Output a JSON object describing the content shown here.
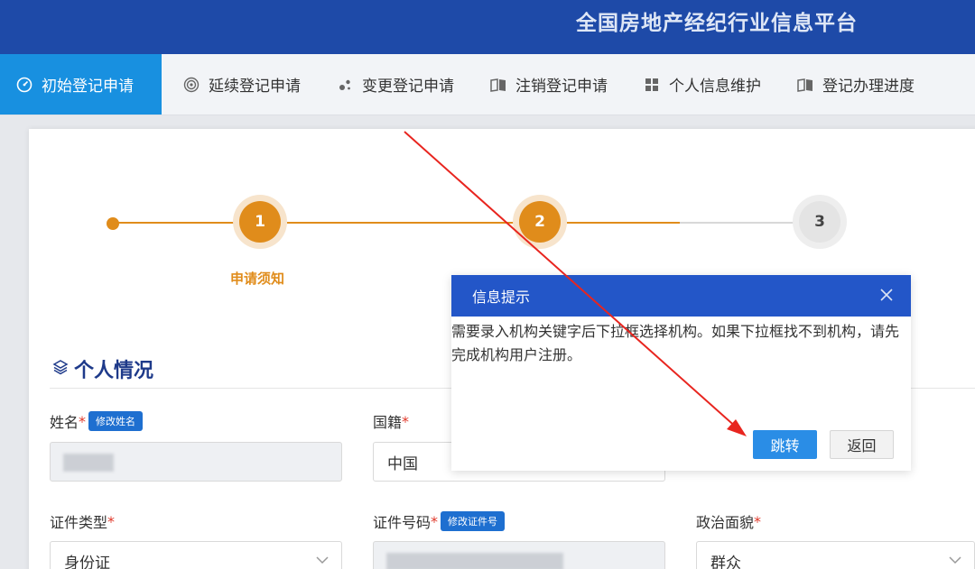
{
  "header": {
    "title": "全国房地产经纪行业信息平台"
  },
  "nav": {
    "items": [
      {
        "label": "初始登记申请",
        "icon": "dashboard-icon",
        "active": true
      },
      {
        "label": "延续登记申请",
        "icon": "target-icon"
      },
      {
        "label": "变更登记申请",
        "icon": "dots-icon"
      },
      {
        "label": "注销登记申请",
        "icon": "book-icon"
      },
      {
        "label": "个人信息维护",
        "icon": "grid-icon"
      },
      {
        "label": "登记办理进度",
        "icon": "book-icon"
      }
    ]
  },
  "stepper": {
    "steps": [
      {
        "number": "1",
        "label": "申请须知",
        "state": "done"
      },
      {
        "number": "2",
        "label": "",
        "state": "active"
      },
      {
        "number": "3",
        "label": "",
        "state": "pending"
      }
    ]
  },
  "section": {
    "title": "个人情况",
    "icon": "layers-icon"
  },
  "form": {
    "name": {
      "label": "姓名",
      "required": "*",
      "tag": "修改姓名"
    },
    "nationality": {
      "label": "国籍",
      "required": "*",
      "value": "中国"
    },
    "id_type": {
      "label": "证件类型",
      "required": "*",
      "value": "身份证"
    },
    "id_number": {
      "label": "证件号码",
      "required": "*",
      "tag": "修改证件号"
    },
    "political": {
      "label": "政治面貌",
      "required": "*",
      "value": "群众"
    }
  },
  "dialog": {
    "title": "信息提示",
    "message": "需要录入机构关键字后下拉框选择机构。如果下拉框找不到机构，请先完成机构用户注册。",
    "confirm_label": "跳转",
    "cancel_label": "返回"
  },
  "colors": {
    "brand": "#1e4aa8",
    "accent": "#1890e0",
    "step": "#e08c1b",
    "dialog_header": "#2356c8",
    "arrow": "#e8251f"
  }
}
